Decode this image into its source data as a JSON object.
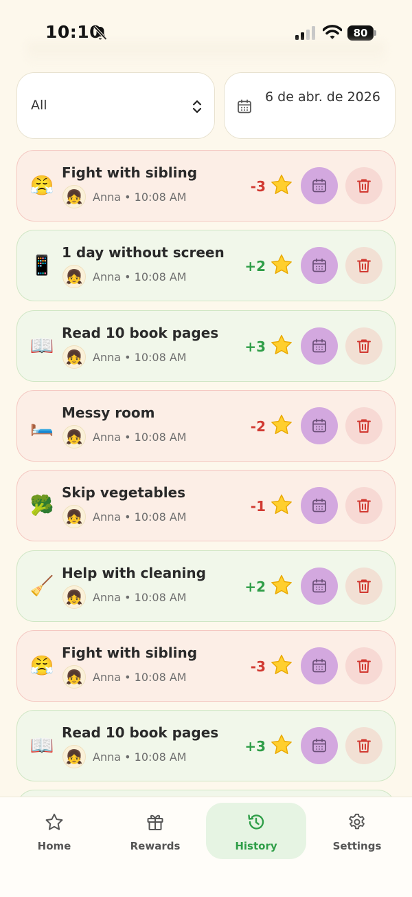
{
  "status_bar": {
    "time": "10:10",
    "battery": "80"
  },
  "filters": {
    "member": "All",
    "date": "6 de abr. de 2026"
  },
  "entries": [
    {
      "title": "Fight with sibling",
      "emoji": "😤",
      "avatar": "👧",
      "member": "Anna",
      "time": "10:08 AM",
      "points": "-3",
      "type": "negative"
    },
    {
      "title": "1 day without screen",
      "emoji": "📱",
      "avatar": "👧",
      "member": "Anna",
      "time": "10:08 AM",
      "points": "+2",
      "type": "positive"
    },
    {
      "title": "Read 10 book pages",
      "emoji": "📖",
      "avatar": "👧",
      "member": "Anna",
      "time": "10:08 AM",
      "points": "+3",
      "type": "positive"
    },
    {
      "title": "Messy room",
      "emoji": "🛏️",
      "avatar": "👧",
      "member": "Anna",
      "time": "10:08 AM",
      "points": "-2",
      "type": "negative"
    },
    {
      "title": "Skip vegetables",
      "emoji": "🥦",
      "avatar": "👧",
      "member": "Anna",
      "time": "10:08 AM",
      "points": "-1",
      "type": "negative"
    },
    {
      "title": "Help with cleaning",
      "emoji": "🧹",
      "avatar": "👧",
      "member": "Anna",
      "time": "10:08 AM",
      "points": "+2",
      "type": "positive"
    },
    {
      "title": "Fight with sibling",
      "emoji": "😤",
      "avatar": "👧",
      "member": "Anna",
      "time": "10:08 AM",
      "points": "-3",
      "type": "negative"
    },
    {
      "title": "Read 10 book pages",
      "emoji": "📖",
      "avatar": "👧",
      "member": "Anna",
      "time": "10:08 AM",
      "points": "+3",
      "type": "positive"
    }
  ],
  "nav": [
    {
      "label": "Home",
      "icon": "star-icon",
      "active": false
    },
    {
      "label": "Rewards",
      "icon": "gift-icon",
      "active": false
    },
    {
      "label": "History",
      "icon": "history-icon",
      "active": true
    },
    {
      "label": "Settings",
      "icon": "gear-icon",
      "active": false
    }
  ],
  "colors": {
    "accent": "#2f9e48",
    "negative": "#d13a32",
    "calendar_button": "#d3a8df"
  }
}
